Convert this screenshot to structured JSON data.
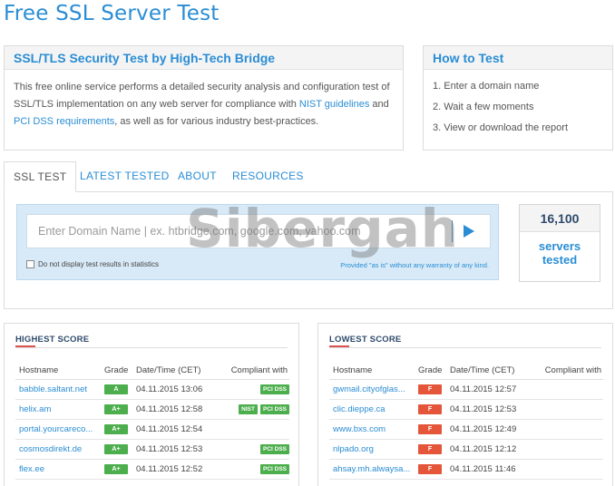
{
  "page": {
    "title": "Free SSL Server Test"
  },
  "about": {
    "heading": "SSL/TLS Security Test by High-Tech Bridge",
    "text_1": "This free online service performs a detailed security analysis and configuration test of SSL/TLS implementation on any web server for compliance with",
    "link_nist": "NIST guidelines",
    "text_2": "and",
    "link_pci": "PCI DSS requirements",
    "text_3": ", as well as for various industry best-practices."
  },
  "howto": {
    "heading": "How to Test",
    "steps": [
      "1. Enter a domain name",
      "2. Wait a few moments",
      "3. View or download the report"
    ]
  },
  "tabs": [
    {
      "label": "SSL TEST",
      "active": true
    },
    {
      "label": "LATEST TESTED",
      "active": false
    },
    {
      "label": "ABOUT",
      "active": false
    },
    {
      "label": "RESOURCES",
      "active": false
    }
  ],
  "search": {
    "placeholder": "Enter Domain Name | ex. htbridge.com, google.com, yahoo.com",
    "checkbox_label": "Do not display test results in statistics",
    "disclaimer": "Provided \"as is\" without any warranty of any kind.",
    "go_icon": "play-triangle-icon"
  },
  "counter": {
    "number": "16,100",
    "label_1": "servers",
    "label_2": "tested"
  },
  "watermark": "Sibergah",
  "highest": {
    "title": "HIGHEST SCORE",
    "columns": [
      "Hostname",
      "Grade",
      "Date/Time (CET)",
      "Compliant with"
    ],
    "rows": [
      {
        "host": "babble.saltant.net",
        "grade": "A",
        "date": "04.11.2015 13:06",
        "nist": "",
        "pci": "PCI DSS"
      },
      {
        "host": "helix.am",
        "grade": "A+",
        "date": "04.11.2015 12:58",
        "nist": "NIST",
        "pci": "PCI DSS"
      },
      {
        "host": "portal.yourcareco...",
        "grade": "A+",
        "date": "04.11.2015 12:54",
        "nist": "",
        "pci": ""
      },
      {
        "host": "cosmosdirekt.de",
        "grade": "A+",
        "date": "04.11.2015 12:53",
        "nist": "",
        "pci": "PCI DSS"
      },
      {
        "host": "flex.ee",
        "grade": "A+",
        "date": "04.11.2015 12:52",
        "nist": "",
        "pci": "PCI DSS"
      }
    ]
  },
  "lowest": {
    "title": "LOWEST SCORE",
    "columns": [
      "Hostname",
      "Grade",
      "Date/Time (CET)",
      "Compliant with"
    ],
    "rows": [
      {
        "host": "gwmail.cityofglas...",
        "grade": "F",
        "date": "04.11.2015 12:57"
      },
      {
        "host": "clic.dieppe.ca",
        "grade": "F",
        "date": "04.11.2015 12:53"
      },
      {
        "host": "www.bxs.com",
        "grade": "F",
        "date": "04.11.2015 12:49"
      },
      {
        "host": "nlpado.org",
        "grade": "F",
        "date": "04.11.2015 12:12"
      },
      {
        "host": "ahsay.mh.alwaysa...",
        "grade": "F",
        "date": "04.11.2015 11:46"
      }
    ]
  },
  "colors": {
    "accent": "#2a8dd4",
    "grade_good": "#4cae4c",
    "grade_bad": "#e4553a",
    "search_bg": "#d8eaf7"
  }
}
